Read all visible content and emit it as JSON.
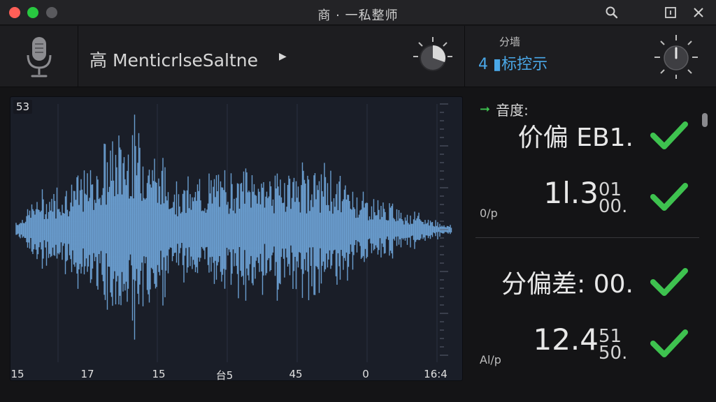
{
  "window": {
    "title": "商 · 一私整师"
  },
  "toolbar": {
    "source_name": "高 MenticrlseSaltne",
    "mode_label": "分墙",
    "mode_value": "4 ▮标控示"
  },
  "waveform": {
    "badge": "53",
    "x_labels": [
      "15",
      "17",
      "15",
      "台5",
      "45",
      "0",
      "16:4"
    ]
  },
  "metrics": {
    "header": "音度:",
    "rows": [
      {
        "main": "价偏 EB1.",
        "status": "ok"
      },
      {
        "main": "1l.3",
        "frac_top": "01",
        "frac_bottom": "00.",
        "unit": "0/p",
        "status": "ok"
      },
      {
        "main": "分偏差: 00.",
        "status": "ok"
      },
      {
        "main": "12.4",
        "frac_top": "51",
        "frac_bottom": "50.",
        "unit": "Al/p",
        "status": "ok"
      }
    ]
  },
  "colors": {
    "accent_blue": "#4aa8e8",
    "check_green": "#3ec24f",
    "wave": "#6a9ed0"
  },
  "icons": [
    "mic-icon",
    "search-icon",
    "window-icon",
    "close-icon",
    "play-arrow-icon",
    "knob-icon",
    "check-icon"
  ]
}
